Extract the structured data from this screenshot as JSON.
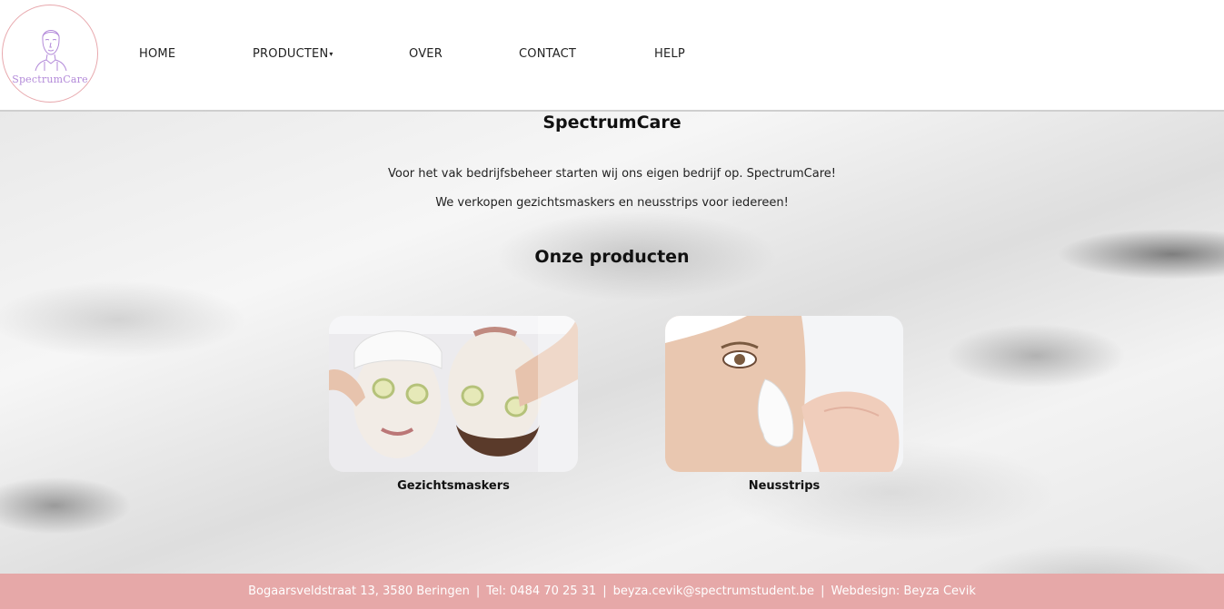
{
  "brand": {
    "logo_text": "SpectrumCare",
    "logo_border_color": "#e8a8ad",
    "logo_text_color": "#b38ad9"
  },
  "nav": {
    "items": [
      {
        "label": "HOME"
      },
      {
        "label": "PRODUCTEN",
        "has_dropdown": true
      },
      {
        "label": "OVER"
      },
      {
        "label": "CONTACT"
      },
      {
        "label": "HELP"
      }
    ]
  },
  "main": {
    "title": "SpectrumCare",
    "intro_lines": [
      "Voor het vak bedrijfsbeheer starten wij ons eigen bedrijf op. SpectrumCare!",
      "We verkopen gezichtsmaskers en neusstrips voor iedereen!"
    ],
    "products_heading": "Onze producten",
    "products": [
      {
        "caption": "Gezichtsmaskers",
        "image": "two-women-face-masks-cucumber-photo"
      },
      {
        "caption": "Neusstrips",
        "image": "woman-applying-nose-strip-photo"
      }
    ]
  },
  "footer": {
    "address": "Bogaarsveldstraat 13, 3580 Beringen",
    "phone": "Tel: 0484 70 25 31",
    "email": "beyza.cevik@spectrumstudent.be",
    "credit": "Webdesign: Beyza Cevik",
    "separator": "|",
    "background_color": "#e6a8a8"
  }
}
